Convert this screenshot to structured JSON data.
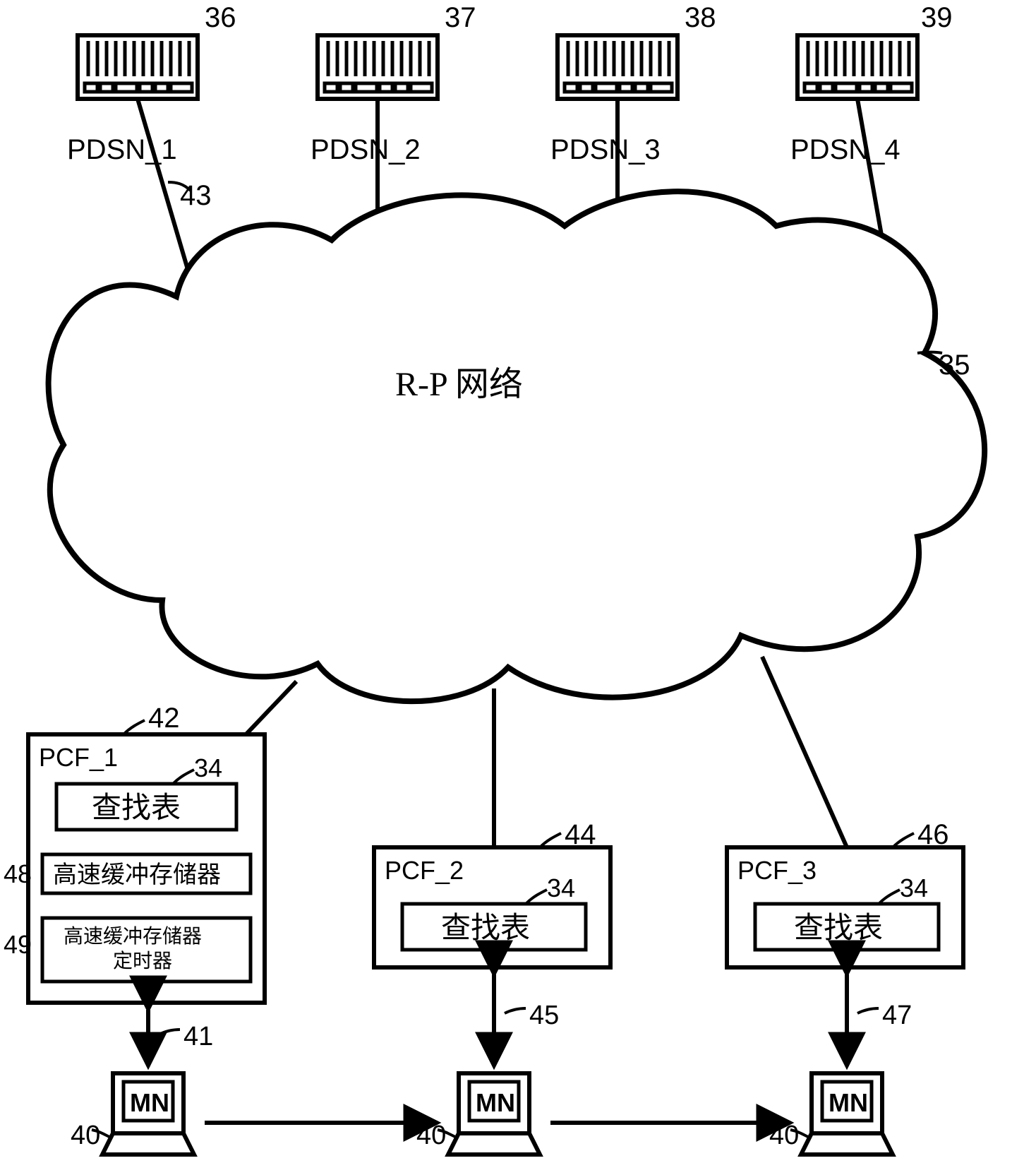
{
  "servers": [
    {
      "num": "36",
      "label": "PDSN_1"
    },
    {
      "num": "37",
      "label": "PDSN_2"
    },
    {
      "num": "38",
      "label": "PDSN_3"
    },
    {
      "num": "39",
      "label": "PDSN_4"
    }
  ],
  "cloud": {
    "label": "R-P 网络",
    "num": "35",
    "link_num": "43"
  },
  "pcf": [
    {
      "name": "PCF_1",
      "num": "42",
      "table_num": "34",
      "lookup_label": "查找表",
      "cache_label": "高速缓冲存储器",
      "cache_num": "48",
      "timer_label": "高速缓冲存储器\n定时器",
      "timer_num": "49",
      "mn_link": "41"
    },
    {
      "name": "PCF_2",
      "num": "44",
      "table_num": "34",
      "lookup_label": "查找表",
      "mn_link": "45"
    },
    {
      "name": "PCF_3",
      "num": "46",
      "table_num": "34",
      "lookup_label": "查找表",
      "mn_link": "47"
    }
  ],
  "mn": {
    "label": "MN",
    "num": "40"
  }
}
